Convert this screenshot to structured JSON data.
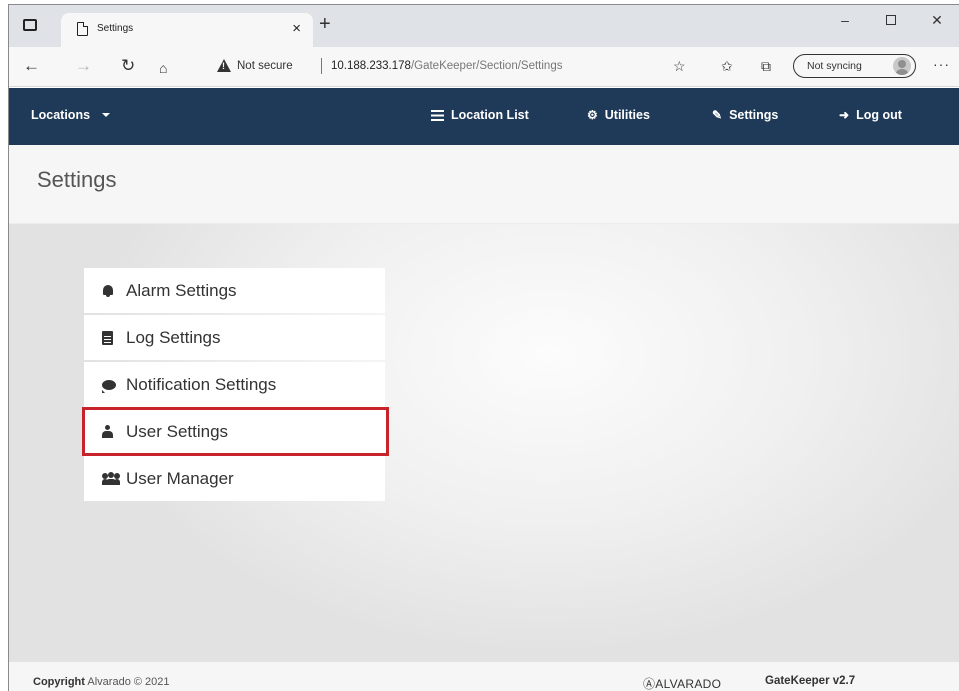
{
  "browser": {
    "tab_title": "Settings",
    "tab_close": "×",
    "new_tab": "+",
    "window_controls": {
      "minimize": "–",
      "close": "✕"
    },
    "not_secure": "Not secure",
    "url_host": "10.188.233.178",
    "url_path": "/GateKeeper/Section/Settings",
    "sync_label": "Not syncing",
    "more": "···"
  },
  "navbar": {
    "locations": "Locations",
    "location_list": "Location List",
    "utilities": "Utilities",
    "settings": "Settings",
    "log_out": "Log out",
    "bg_color": "#1f3a58"
  },
  "page": {
    "title": "Settings"
  },
  "settings_menu": {
    "items": [
      {
        "label": "Alarm Settings",
        "icon": "bell-icon"
      },
      {
        "label": "Log Settings",
        "icon": "file-icon"
      },
      {
        "label": "Notification Settings",
        "icon": "comment-icon"
      },
      {
        "label": "User Settings",
        "icon": "user-icon",
        "highlighted": true
      },
      {
        "label": "User Manager",
        "icon": "users-icon"
      }
    ],
    "highlight_color": "#c8222a"
  },
  "footer": {
    "copyright_bold": "Copyright",
    "copyright_rest": " Alvarado © 2021",
    "brand": "ⒶALVARADO",
    "version": "GateKeeper v2.7"
  }
}
